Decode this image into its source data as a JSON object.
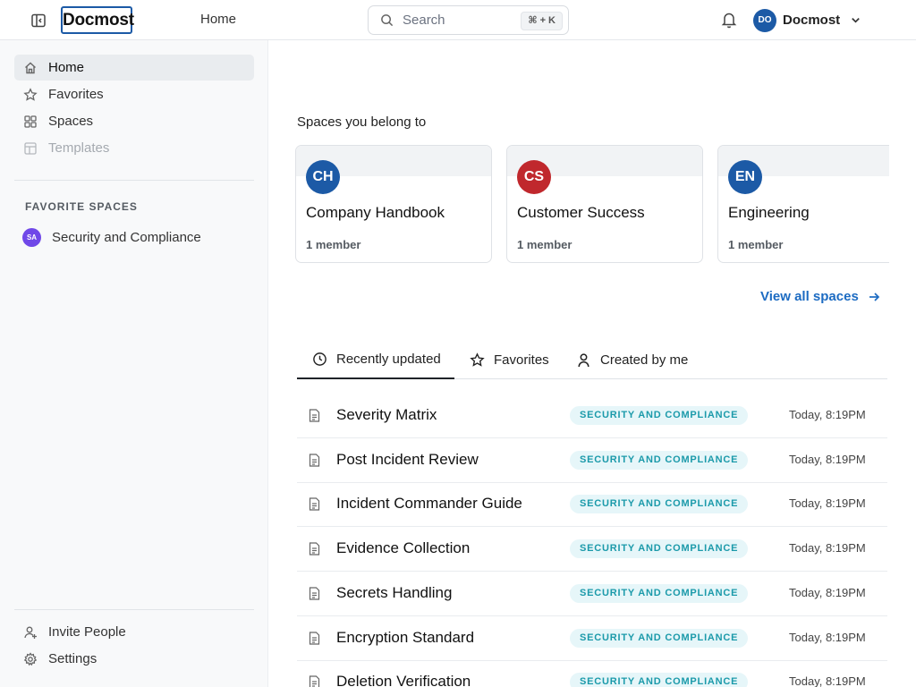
{
  "header": {
    "logo": "Docmost",
    "nav_home": "Home",
    "search_placeholder": "Search",
    "search_shortcut": "⌘ + K",
    "user_initials": "DO",
    "user_name": "Docmost"
  },
  "sidebar": {
    "items": [
      {
        "label": "Home",
        "icon": "home-icon",
        "active": true
      },
      {
        "label": "Favorites",
        "icon": "star-icon"
      },
      {
        "label": "Spaces",
        "icon": "grid-icon"
      },
      {
        "label": "Templates",
        "icon": "template-icon",
        "disabled": true
      }
    ],
    "favorite_heading": "FAVORITE SPACES",
    "favorite_spaces": [
      {
        "initials": "SA",
        "name": "Security and Compliance",
        "color": "#7048e8"
      }
    ],
    "bottom_items": [
      {
        "label": "Invite People",
        "icon": "user-plus-icon"
      },
      {
        "label": "Settings",
        "icon": "gear-icon"
      }
    ]
  },
  "main": {
    "spaces_title": "Spaces you belong to",
    "spaces": [
      {
        "initials": "CH",
        "name": "Company Handbook",
        "members": "1 member",
        "color": "#1c5aa6"
      },
      {
        "initials": "CS",
        "name": "Customer Success",
        "members": "1 member",
        "color": "#c0282d"
      },
      {
        "initials": "EN",
        "name": "Engineering",
        "members": "1 member",
        "color": "#1c5aa6"
      }
    ],
    "view_all": "View all spaces",
    "tabs": [
      {
        "label": "Recently updated",
        "icon": "clock-icon",
        "active": true
      },
      {
        "label": "Favorites",
        "icon": "star-icon"
      },
      {
        "label": "Created by me",
        "icon": "user-icon"
      }
    ],
    "pages": [
      {
        "title": "Severity Matrix",
        "space": "SECURITY AND COMPLIANCE",
        "updated": "Today, 8:19PM"
      },
      {
        "title": "Post Incident Review",
        "space": "SECURITY AND COMPLIANCE",
        "updated": "Today, 8:19PM"
      },
      {
        "title": "Incident Commander Guide",
        "space": "SECURITY AND COMPLIANCE",
        "updated": "Today, 8:19PM"
      },
      {
        "title": "Evidence Collection",
        "space": "SECURITY AND COMPLIANCE",
        "updated": "Today, 8:19PM"
      },
      {
        "title": "Secrets Handling",
        "space": "SECURITY AND COMPLIANCE",
        "updated": "Today, 8:19PM"
      },
      {
        "title": "Encryption Standard",
        "space": "SECURITY AND COMPLIANCE",
        "updated": "Today, 8:19PM"
      },
      {
        "title": "Deletion Verification",
        "space": "SECURITY AND COMPLIANCE",
        "updated": "Today, 8:19PM"
      }
    ]
  }
}
